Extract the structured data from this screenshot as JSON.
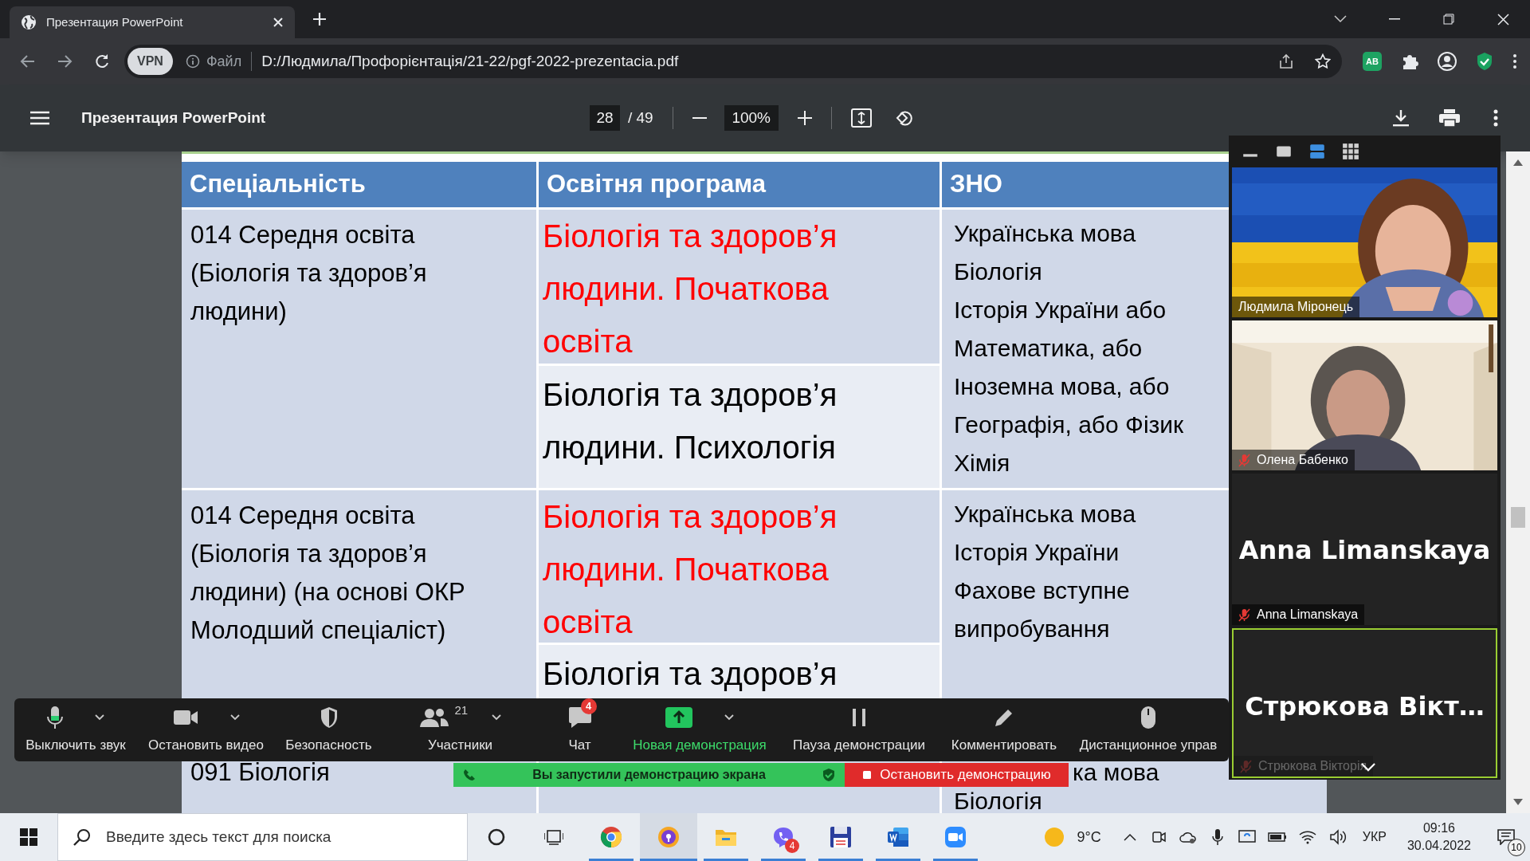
{
  "browser": {
    "tab_title": "Презентация PowerPoint",
    "vpn_badge": "VPN",
    "scheme": "Файл",
    "url": "D:/Людмила/Профорієнтація/21-22/pgf-2022-prezentacia.pdf",
    "extension_badge": "AB"
  },
  "pdf_toolbar": {
    "title": "Презентация PowerPoint",
    "page": "28",
    "page_count": "/ 49",
    "zoom": "100%"
  },
  "slide": {
    "columns": [
      "Спеціальність",
      "Освітня програма",
      "ЗНО"
    ],
    "rows": [
      {
        "kind": "full",
        "specialty": "014 Середня освіта\n(Біологія та здоров’я\nлюдини)",
        "programs": [
          {
            "text": "Біологія та здоров’я\nлюдини. Початкова\nосвіта",
            "highlighted": true
          },
          {
            "text": "Біологія та здоров’я\nлюдини. Психологія",
            "highlighted": false
          }
        ],
        "exams": [
          "Українська мова",
          "Біологія",
          "Історія України або",
          "Математика, або",
          "Іноземна мова, або",
          "Географія, або Фізик",
          "Хімія"
        ]
      },
      {
        "kind": "full",
        "specialty": "014 Середня освіта\n(Біологія та здоров’я\nлюдини) (на основі ОКР\nМолодший спеціаліст)",
        "programs": [
          {
            "text": "Біологія та здоров’я\nлюдини. Початкова\nосвіта",
            "highlighted": true
          },
          {
            "text": "Біологія та здоров’я",
            "highlighted": false
          }
        ],
        "exams": [
          "Українська мова",
          "Історія України",
          "Фахове вступне",
          "випробування"
        ]
      },
      {
        "kind": "partial",
        "specialty": "091 Біологія",
        "programs": [],
        "exams": [
          "ка мова",
          "Біологія"
        ]
      }
    ]
  },
  "zoom_panel": {
    "view_modes": [
      {
        "kind": "minimize",
        "selected": false
      },
      {
        "kind": "speaker",
        "selected": false
      },
      {
        "kind": "strip",
        "selected": true
      },
      {
        "kind": "grid",
        "selected": false
      }
    ],
    "participants": [
      {
        "kind": "video",
        "name": "Людмила Міронець",
        "muted": false,
        "active": false,
        "faded": false
      },
      {
        "kind": "room-video",
        "name": "Олена Бабенко",
        "muted": true,
        "active": false,
        "faded": false
      },
      {
        "kind": "avatar",
        "display_name": "Anna Limanskaya",
        "name": "Anna Limanskaya",
        "muted": true,
        "active": false,
        "faded": false
      },
      {
        "kind": "avatar",
        "display_name": "Стрюкова Вікт…",
        "name": "Стрюкова Вікторія",
        "muted": true,
        "active": true,
        "faded": true
      }
    ]
  },
  "meeting_toolbar": [
    {
      "kind": "mic",
      "label": "Выключить звук",
      "has_menu": true
    },
    {
      "kind": "video",
      "label": "Остановить видео",
      "has_menu": true
    },
    {
      "kind": "security",
      "label": "Безопасность",
      "has_menu": false
    },
    {
      "kind": "participants",
      "label": "Участники",
      "count": "21",
      "has_menu": true
    },
    {
      "kind": "chat",
      "label": "Чат",
      "badge": "4",
      "has_menu": false
    },
    {
      "kind": "share",
      "label": "Новая демонстрация",
      "has_menu": true
    },
    {
      "kind": "pause",
      "label": "Пауза демонстрации",
      "has_menu": false
    },
    {
      "kind": "annotate",
      "label": "Комментировать",
      "has_menu": false
    },
    {
      "kind": "remote",
      "label": "Дистанционное управ",
      "has_menu": false
    }
  ],
  "share_banner": {
    "message": "Вы запустили демонстрацию экрана",
    "stop_button": "Остановить демонстрацию"
  },
  "taskbar": {
    "search_placeholder": "Введите здесь текст для поиска",
    "apps": [
      {
        "kind": "chrome",
        "active": false,
        "running": true
      },
      {
        "kind": "vpn",
        "active": true,
        "running": true
      },
      {
        "kind": "explorer",
        "active": false,
        "running": true
      },
      {
        "kind": "viber",
        "active": false,
        "running": true,
        "badge": "4"
      },
      {
        "kind": "save",
        "active": false,
        "running": true
      },
      {
        "kind": "word",
        "active": false,
        "running": true
      },
      {
        "kind": "zoom",
        "active": false,
        "running": true
      }
    ],
    "temperature": "9°C",
    "language": "УКР",
    "time": "09:16",
    "date": "30.04.2022",
    "notifications": "10"
  }
}
